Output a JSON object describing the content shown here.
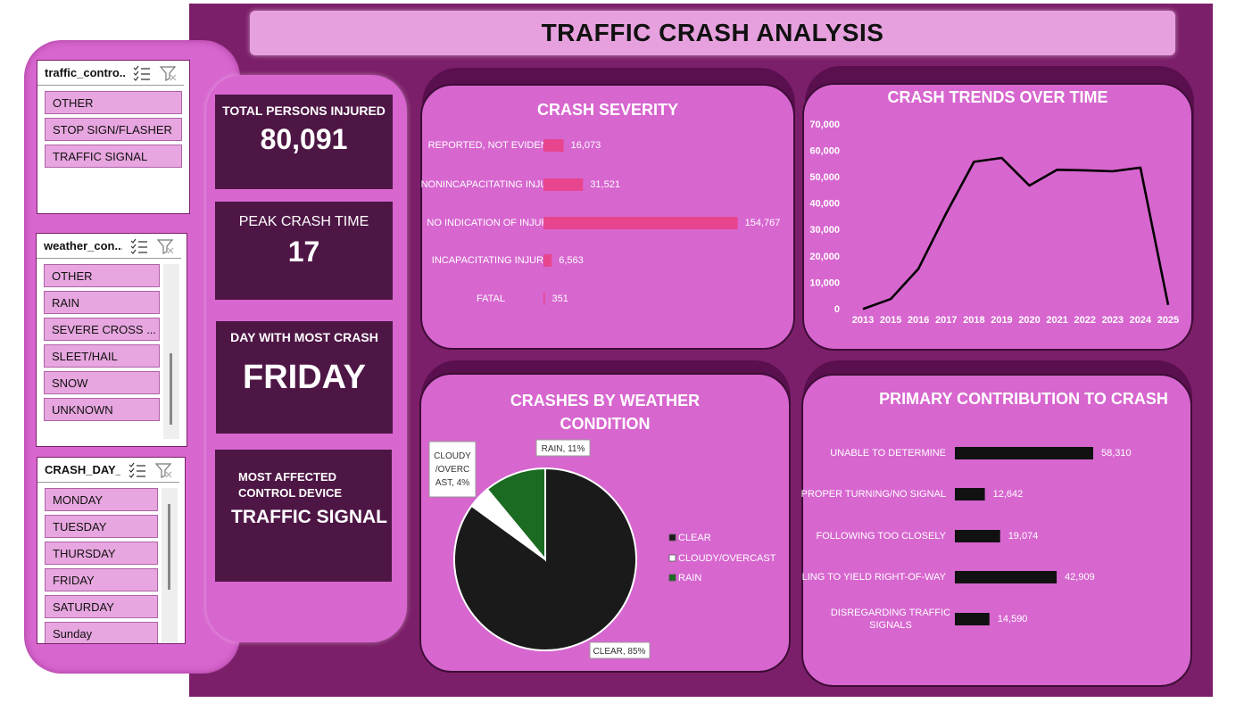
{
  "dashboard": {
    "title": "TRAFFIC CRASH ANALYSIS"
  },
  "slicers": {
    "traffic_control": {
      "title": "traffic_contro...",
      "items": [
        "OTHER",
        "STOP SIGN/FLASHER",
        "TRAFFIC SIGNAL"
      ]
    },
    "weather": {
      "title": "weather_con...",
      "items": [
        "OTHER",
        "RAIN",
        "SEVERE CROSS ...",
        "SLEET/HAIL",
        "SNOW",
        "UNKNOWN"
      ]
    },
    "crash_day": {
      "title": "CRASH_DAY_...",
      "items": [
        "MONDAY",
        "TUESDAY",
        "THURSDAY",
        "FRIDAY",
        "SATURDAY",
        "Sunday"
      ]
    }
  },
  "kpis": {
    "injured": {
      "label": "TOTAL PERSONS INJURED",
      "value": "80,091"
    },
    "peak_time": {
      "label": "PEAK CRASH TIME",
      "value": "17"
    },
    "day": {
      "label": "DAY WITH MOST CRASH",
      "value": "FRIDAY"
    },
    "device": {
      "label": "MOST AFFECTED CONTROL DEVICE",
      "value": "TRAFFIC SIGNAL"
    }
  },
  "colors": {
    "background": "#7c1f6a",
    "panel": "#d766cf",
    "title_bar": "#e6a0de",
    "kpi_box": "#4e1645",
    "severity_bar": "#e8458f",
    "contribution_bar": "#111111",
    "pie_clear": "#1a1a1a",
    "pie_cloudy": "#ffffff",
    "pie_rain": "#1b6b22"
  },
  "chart_data": [
    {
      "id": "severity",
      "type": "bar",
      "orientation": "horizontal",
      "title": "CRASH SEVERITY",
      "categories": [
        "REPORTED, NOT EVIDENT",
        "NONINCAPACITATING INJURY",
        "NO INDICATION OF INJURY",
        "INCAPACITATING INJURY",
        "FATAL"
      ],
      "values": [
        16073,
        31521,
        154767,
        6563,
        351
      ],
      "labels": [
        "16,073",
        "31,521",
        "154,767",
        "6,563",
        "351"
      ],
      "xlim": [
        0,
        160000
      ]
    },
    {
      "id": "trends",
      "type": "line",
      "title": "CRASH TRENDS OVER TIME",
      "x": [
        "2013",
        "2015",
        "2016",
        "2017",
        "2018",
        "2019",
        "2020",
        "2021",
        "2022",
        "2023",
        "2024",
        "2025"
      ],
      "values": [
        200,
        4000,
        15500,
        36500,
        56000,
        57500,
        47000,
        53000,
        52800,
        52400,
        53800,
        1800
      ],
      "ylim": [
        0,
        70000
      ],
      "yticks": [
        "70,000",
        "60,000",
        "50,000",
        "40,000",
        "30,000",
        "20,000",
        "10,000",
        "0"
      ],
      "grid": false
    },
    {
      "id": "weather",
      "type": "pie",
      "title": "CRASHES BY WEATHER CONDITION",
      "categories": [
        "CLEAR",
        "CLOUDY/OVERCAST",
        "RAIN"
      ],
      "values": [
        85,
        4,
        11
      ],
      "labels": [
        "CLEAR, 85%",
        "CLOUDY /OVERC AST, 4%",
        "RAIN, 11%"
      ],
      "legend": [
        "CLEAR",
        "CLOUDY/OVERCAST",
        "RAIN"
      ],
      "legend_position": "right"
    },
    {
      "id": "contribution",
      "type": "bar",
      "orientation": "horizontal",
      "title": "PRIMARY CONTRIBUTION TO CRASH",
      "categories": [
        "UNABLE TO DETERMINE",
        "IMPROPER TURNING/NO SIGNAL",
        "FOLLOWING TOO CLOSELY",
        "FAILING TO YIELD RIGHT-OF-WAY",
        "DISREGARDING TRAFFIC SIGNALS"
      ],
      "values": [
        58310,
        12642,
        19074,
        42909,
        14590
      ],
      "labels": [
        "58,310",
        "12,642",
        "19,074",
        "42,909",
        "14,590"
      ],
      "xlim": [
        0,
        70000
      ]
    }
  ]
}
